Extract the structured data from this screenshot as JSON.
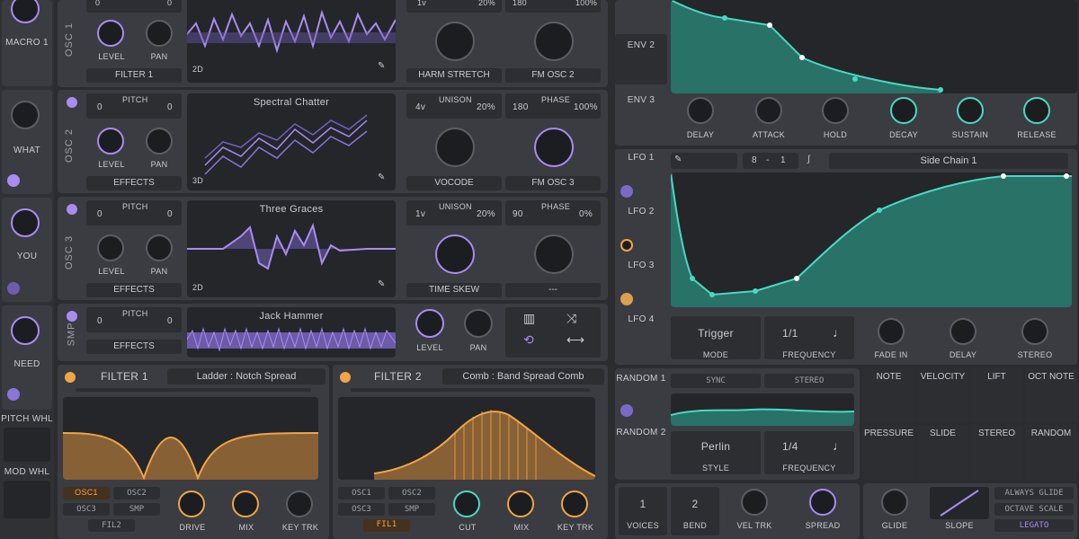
{
  "macros": [
    {
      "label": "MACRO 1"
    },
    {
      "label": "WHAT"
    },
    {
      "label": "YOU"
    },
    {
      "label": "NEED"
    }
  ],
  "wheels": {
    "pitch": "PITCH WHL",
    "mod": "MOD WHL"
  },
  "osc1": {
    "name": "OSC 1",
    "pitch_l": "0",
    "pitch_r": "0",
    "level": "LEVEL",
    "pan": "PAN",
    "dest": "FILTER 1",
    "dim": "2D",
    "uni_l": "1v",
    "uni_r": "20%",
    "phase_l": "180",
    "phase_r": "100%",
    "k1": "HARM STRETCH",
    "k2": "FM OSC 2"
  },
  "osc2": {
    "name": "OSC 2",
    "pitch": "PITCH",
    "pitch_l": "0",
    "pitch_r": "0",
    "level": "LEVEL",
    "pan": "PAN",
    "dest": "EFFECTS",
    "wavetable": "Spectral Chatter",
    "dim": "3D",
    "unison": "UNISON",
    "uni_l": "4v",
    "uni_r": "20%",
    "phase": "PHASE",
    "phase_l": "180",
    "phase_r": "100%",
    "k1": "VOCODE",
    "k2": "FM OSC 3"
  },
  "osc3": {
    "name": "OSC 3",
    "pitch": "PITCH",
    "pitch_l": "0",
    "pitch_r": "0",
    "level": "LEVEL",
    "pan": "PAN",
    "dest": "EFFECTS",
    "wavetable": "Three Graces",
    "dim": "2D",
    "unison": "UNISON",
    "uni_l": "1v",
    "uni_r": "20%",
    "phase": "PHASE",
    "phase_l": "90",
    "phase_r": "0%",
    "k1": "TIME SKEW",
    "k2": "---"
  },
  "smp": {
    "name": "SMP",
    "pitch": "PITCH",
    "pitch_l": "0",
    "pitch_r": "0",
    "dest": "EFFECTS",
    "sample": "Jack Hammer",
    "level": "LEVEL",
    "pan": "PAN"
  },
  "filter1": {
    "name": "FILTER 1",
    "type": "Ladder : Notch Spread",
    "osc1": "OSC1",
    "osc2": "OSC2",
    "osc3": "OSC3",
    "smp": "SMP",
    "fil": "FIL2",
    "drive": "DRIVE",
    "mix": "MIX",
    "keytrk": "KEY TRK"
  },
  "filter2": {
    "name": "FILTER 2",
    "type": "Comb : Band Spread Comb",
    "osc1": "OSC1",
    "osc2": "OSC2",
    "osc3": "OSC3",
    "smp": "SMP",
    "fil": "FIL1",
    "cut": "CUT",
    "mix": "MIX",
    "keytrk": "KEY TRK"
  },
  "env": {
    "tabs": [
      "ENV 2",
      "ENV 3"
    ],
    "knobs": [
      "DELAY",
      "ATTACK",
      "HOLD",
      "DECAY",
      "SUSTAIN",
      "RELEASE"
    ]
  },
  "lfo": {
    "tabs": [
      "LFO 1",
      "LFO 2",
      "LFO 3",
      "LFO 4"
    ],
    "grid_l": "8",
    "grid_sep": "-",
    "grid_r": "1",
    "shape": "Side Chain 1",
    "mode": "Trigger",
    "mode_lbl": "MODE",
    "freq": "1/1",
    "freq_lbl": "FREQUENCY",
    "k1": "FADE IN",
    "k2": "DELAY",
    "k3": "STEREO"
  },
  "random": {
    "tabs": [
      "RANDOM 1",
      "RANDOM 2"
    ],
    "sync": "SYNC",
    "stereo": "STEREO",
    "style": "Perlin",
    "style_lbl": "STYLE",
    "freq": "1/4",
    "freq_lbl": "FREQUENCY"
  },
  "mods": {
    "row1": [
      "NOTE",
      "VELOCITY",
      "LIFT",
      "OCT NOTE"
    ],
    "row2": [
      "PRESSURE",
      "SLIDE",
      "STEREO",
      "RANDOM"
    ]
  },
  "voice": {
    "voices": "1",
    "voices_lbl": "VOICES",
    "bend": "2",
    "bend_lbl": "BEND",
    "veltrk": "VEL TRK",
    "spread": "SPREAD",
    "glide": "GLIDE",
    "slope": "SLOPE",
    "always": "ALWAYS GLIDE",
    "octave": "OCTAVE SCALE",
    "legato": "LEGATO"
  },
  "colors": {
    "purple": "#a98cf0",
    "orange": "#f0a548",
    "teal": "#49d9c2"
  }
}
